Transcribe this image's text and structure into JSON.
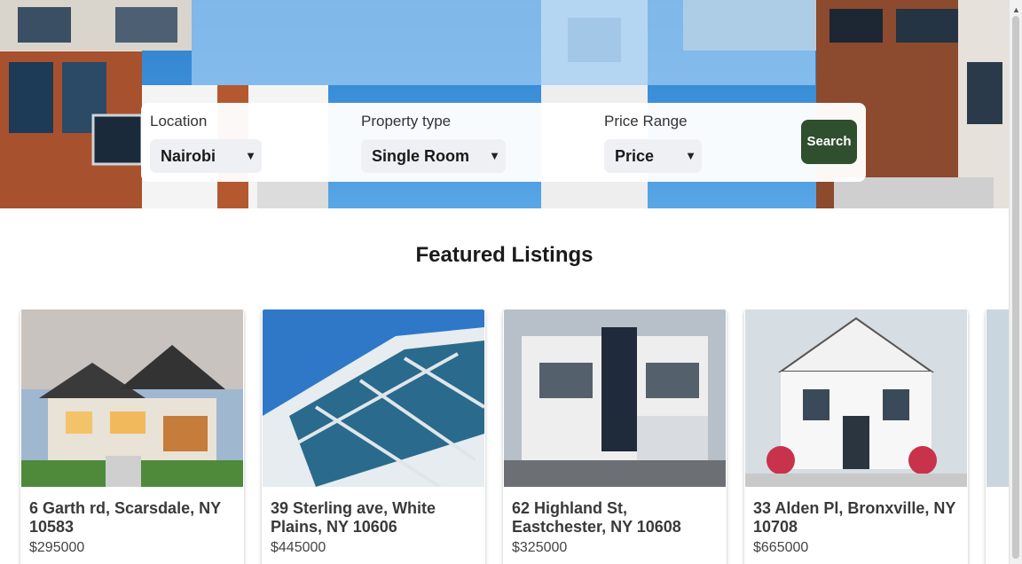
{
  "search": {
    "location_label": "Location",
    "location_value": "Nairobi",
    "property_type_label": "Property type",
    "property_type_value": "Single Room",
    "price_label": "Price Range",
    "price_value": "Price",
    "button_label": "Search"
  },
  "featured": {
    "title": "Featured Listings",
    "listings": [
      {
        "address": "6 Garth rd, Scarsdale, NY 10583",
        "price": "$295000"
      },
      {
        "address": "39 Sterling ave, White Plains, NY 10606",
        "price": "$445000"
      },
      {
        "address": "62 Highland St, Eastchester, NY 10608",
        "price": "$325000"
      },
      {
        "address": "33 Alden Pl, Bronxville, NY 10708",
        "price": "$665000"
      }
    ]
  },
  "icons": {
    "dropdown": "chevron-down-icon",
    "scroll_up": "arrow-up-icon"
  },
  "colors": {
    "search_button": "#2f4f2f",
    "hero_sky": "#3f93dd"
  }
}
